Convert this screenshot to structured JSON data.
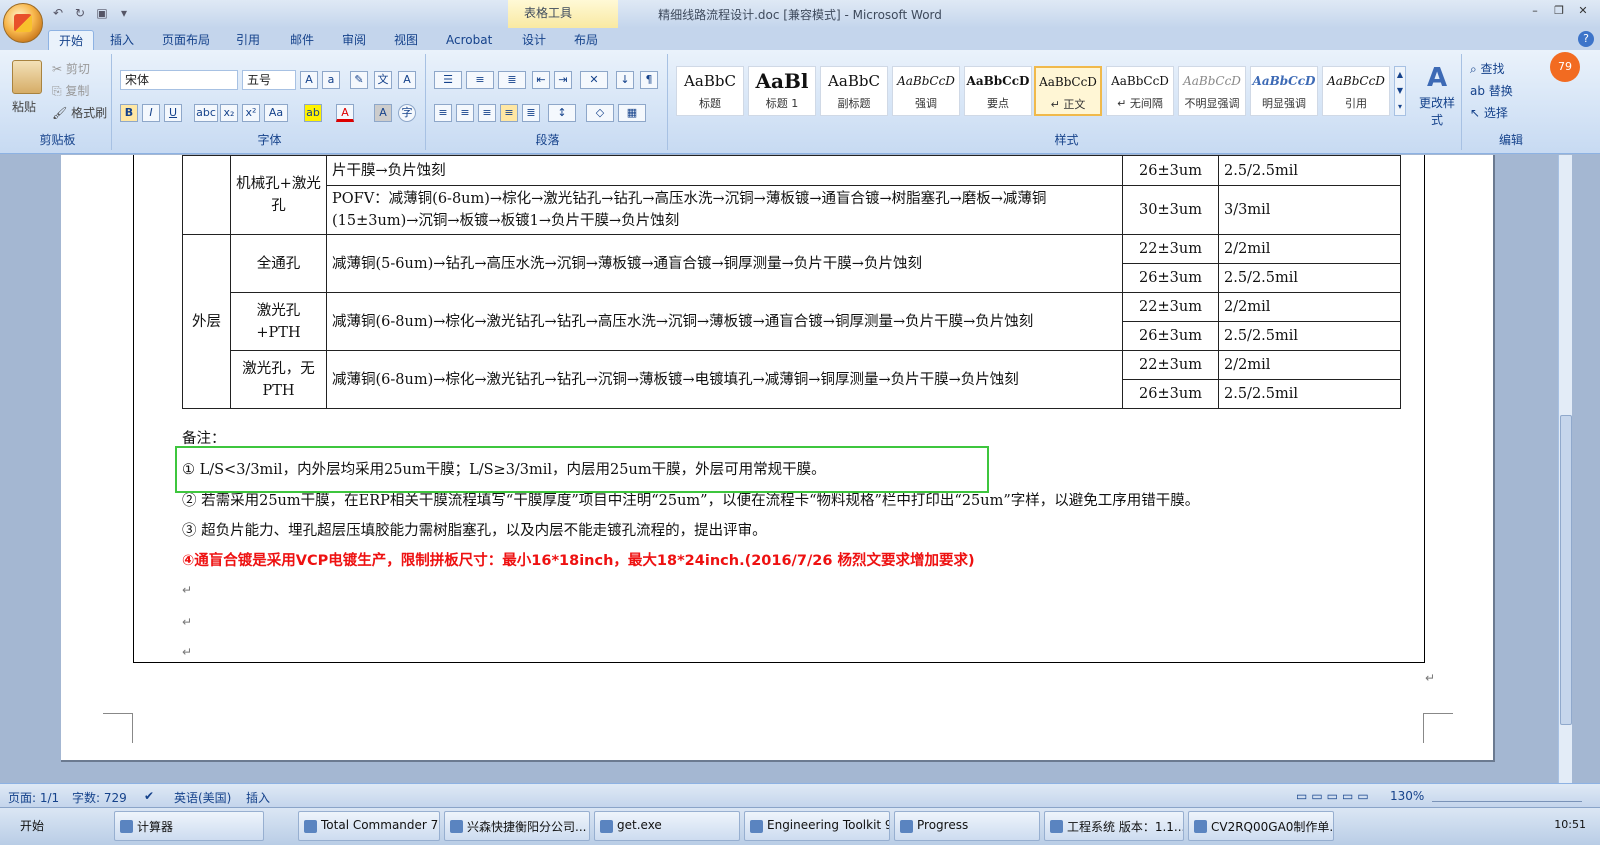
{
  "window": {
    "title": "精细线路流程设计.doc [兼容模式] - Microsoft Word",
    "context_tab": "表格工具"
  },
  "ribbon_tabs": [
    "开始",
    "插入",
    "页面布局",
    "引用",
    "邮件",
    "审阅",
    "视图",
    "Acrobat",
    "设计",
    "布局"
  ],
  "clipboard": {
    "paste": "粘贴",
    "cut": "剪切",
    "copy": "复制",
    "format_painter": "格式刷",
    "label": "剪贴板"
  },
  "font": {
    "name": "宋体",
    "size": "五号",
    "label": "字体"
  },
  "paragraph": {
    "label": "段落"
  },
  "styles": {
    "label": "样式",
    "items": [
      {
        "sample": "AaBbC",
        "name": "标题"
      },
      {
        "sample": "AaBl",
        "name": "标题 1"
      },
      {
        "sample": "AaBbC",
        "name": "副标题"
      },
      {
        "sample": "AaBbCcD",
        "name": "强调"
      },
      {
        "sample": "AaBbCcD",
        "name": "要点"
      },
      {
        "sample": "AaBbCcD",
        "name": "↵ 正文"
      },
      {
        "sample": "AaBbCcD",
        "name": "↵ 无间隔"
      },
      {
        "sample": "AaBbCcD",
        "name": "不明显强调"
      },
      {
        "sample": "AaBbCcD",
        "name": "明显强调"
      },
      {
        "sample": "AaBbCcD",
        "name": "引用"
      }
    ],
    "change_styles": "更改样式"
  },
  "editing": {
    "find": "查找",
    "replace": "替换",
    "select": "选择",
    "label": "编辑"
  },
  "table": {
    "rows": [
      {
        "c1": "",
        "c2": "机械孔+激光孔",
        "c3": "片干膜→负片蚀刻",
        "c4": "26±3um",
        "c5": "2.5/2.5mil"
      },
      {
        "c3": "POFV：减薄铜(6-8um)→棕化→激光钻孔→钻孔→高压水洗→沉铜→薄板镀→通盲合镀→树脂塞孔→磨板→减薄铜(15±3um)→沉铜→板镀→板镀1→负片干膜→负片蚀刻",
        "c4": "30±3um",
        "c5": "3/3mil"
      },
      {
        "c1": "外层",
        "c2": "全通孔",
        "c3": "减薄铜(5-6um)→钻孔→高压水洗→沉铜→薄板镀→通盲合镀→铜厚测量→负片干膜→负片蚀刻",
        "c4": "22±3um",
        "c5": "2/2mil"
      },
      {
        "c4": "26±3um",
        "c5": "2.5/2.5mil"
      },
      {
        "c2": "激光孔+PTH",
        "c3": "减薄铜(6-8um)→棕化→激光钻孔→钻孔→高压水洗→沉铜→薄板镀→通盲合镀→铜厚测量→负片干膜→负片蚀刻",
        "c4": "22±3um",
        "c5": "2/2mil"
      },
      {
        "c4": "26±3um",
        "c5": "2.5/2.5mil"
      },
      {
        "c2": "激光孔，无PTH",
        "c3": "减薄铜(6-8um)→棕化→激光钻孔→钻孔→沉铜→薄板镀→电镀填孔→减薄铜→铜厚测量→负片干膜→负片蚀刻",
        "c4": "22±3um",
        "c5": "2/2mil"
      },
      {
        "c4": "26±3um",
        "c5": "2.5/2.5mil"
      }
    ]
  },
  "notes": {
    "heading": "备注：",
    "n1": "① L/S<3/3mil，内外层均采用25um干膜；L/S≥3/3mil，内层用25um干膜，外层可用常规干膜。",
    "n2": "② 若需采用25um干膜，在ERP相关干膜流程填写“干膜厚度”项目中注明“25um”，以便在流程卡“物料规格”栏中打印出“25um”字样，以避免工序用错干膜。",
    "n3": "③ 超负片能力、埋孔超层压填胶能力需树脂塞孔，以及内层不能走镀孔流程的，提出评审。",
    "n4": "④通盲合镀是采用VCP电镀生产，限制拼板尺寸：最小16*18inch，最大18*24inch.(2016/7/26 杨烈文要求增加要求)"
  },
  "status": {
    "page": "页面: 1/1",
    "words": "字数: 729",
    "language": "英语(美国)",
    "mode": "插入",
    "zoom": "130%"
  },
  "taskbar": {
    "start": "开始",
    "items": [
      "计算器",
      "Total Commander 7.0 ...",
      "兴森快捷衡阳分公司...",
      "get.exe",
      "Engineering Toolkit 9.0...",
      "Progress",
      "工程系统 版本：1.1...",
      "CV2RQ00GA0制作单...."
    ],
    "clock": "10:51"
  },
  "colors": {
    "highlight_box": "#3ec63e",
    "note_red": "#e11111"
  }
}
